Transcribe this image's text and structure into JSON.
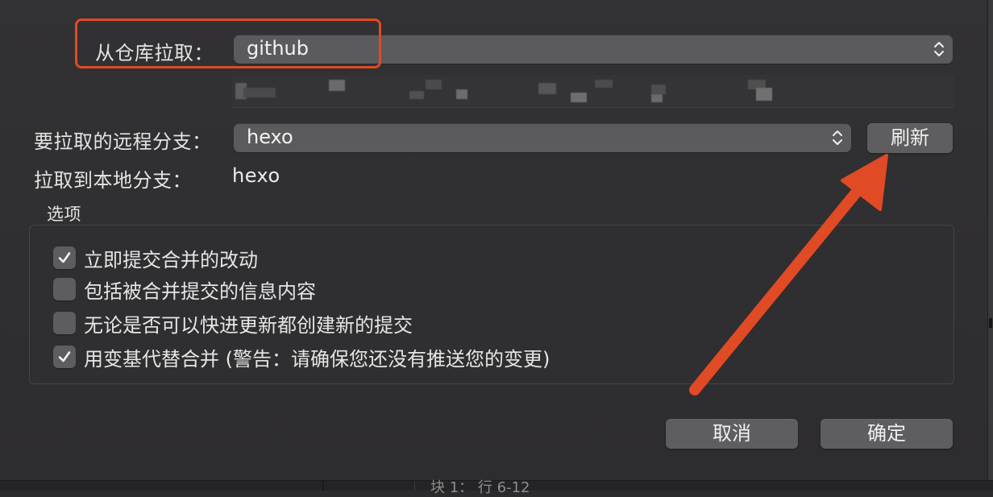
{
  "dialog": {
    "remote_label": "从仓库拉取：",
    "remote_value": "github",
    "branch_label": "要拉取的远程分支：",
    "branch_value": "hexo",
    "refresh_button": "刷新",
    "local_label": "拉取到本地分支：",
    "local_value": "hexo",
    "options_title": "选项",
    "options": [
      {
        "label": "立即提交合并的改动",
        "checked": true
      },
      {
        "label": "包括被合并提交的信息内容",
        "checked": false
      },
      {
        "label": "无论是否可以快进更新都创建新的提交",
        "checked": false
      },
      {
        "label": "用变基代替合并 (警告：请确保您还没有推送您的变更)",
        "checked": true
      }
    ],
    "cancel_button": "取消",
    "ok_button": "确定"
  },
  "background": {
    "status_peek": "块 1： 行 6-12"
  },
  "colors": {
    "annotation": "#e04a25",
    "dialog_bg": "#2d2c2e",
    "control_bg": "#5b5a5c"
  },
  "icons": [
    "popup-stepper-icon",
    "checkmark-icon",
    "annotation-arrow-icon"
  ]
}
